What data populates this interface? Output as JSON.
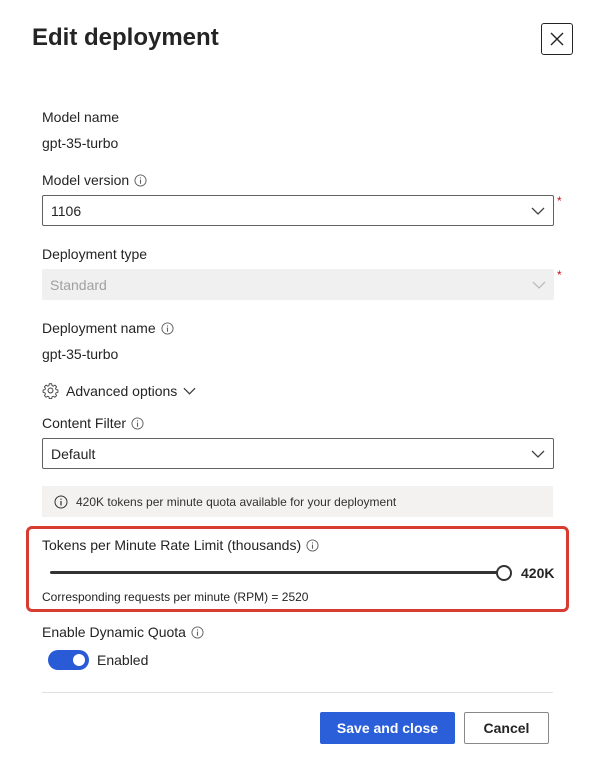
{
  "panel": {
    "title": "Edit deployment",
    "close_icon": "close-icon"
  },
  "model_name": {
    "label": "Model name",
    "value": "gpt-35-turbo"
  },
  "model_version": {
    "label": "Model version",
    "value": "1106",
    "required_mark": "*"
  },
  "deployment_type": {
    "label": "Deployment type",
    "value": "Standard",
    "required_mark": "*"
  },
  "deployment_name": {
    "label": "Deployment name",
    "value": "gpt-35-turbo"
  },
  "advanced_options": {
    "label": "Advanced options"
  },
  "content_filter": {
    "label": "Content Filter",
    "value": "Default"
  },
  "quota_banner": {
    "text": "420K tokens per minute quota available for your deployment"
  },
  "rate_limit": {
    "label": "Tokens per Minute Rate Limit (thousands)",
    "value_label": "420K",
    "slider_level": 1.0,
    "rpm_text": "Corresponding requests per minute (RPM) = 2520"
  },
  "dynamic_quota": {
    "label": "Enable Dynamic Quota",
    "toggle_label": "Enabled",
    "enabled": true
  },
  "footer": {
    "save_label": "Save and close",
    "cancel_label": "Cancel"
  },
  "colors": {
    "primary": "#2b5fd9",
    "highlight": "#d83b2f",
    "required": "#c50f1f"
  }
}
